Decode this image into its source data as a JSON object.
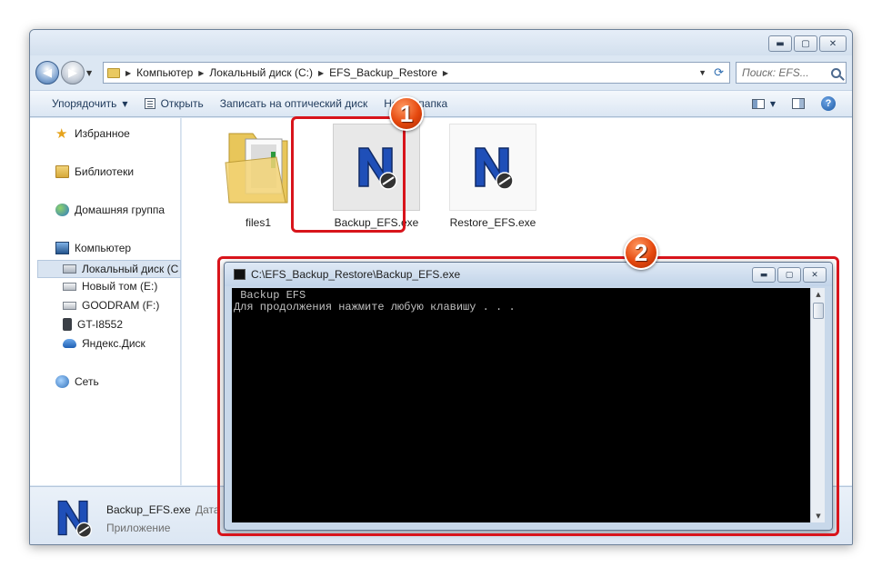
{
  "explorer": {
    "window_controls": {
      "minimize": "▬",
      "maximize": "▢",
      "close": "✕"
    },
    "nav": {
      "back": "◀",
      "forward": "▶",
      "history": "▼"
    },
    "address": {
      "crumbs": [
        "Компьютер",
        "Локальный диск (C:)",
        "EFS_Backup_Restore"
      ],
      "separator": "▶",
      "dropdown": "▼",
      "refresh": "⟳"
    },
    "search": {
      "placeholder": "Поиск: EFS..."
    },
    "toolbar": {
      "organize": "Упорядочить",
      "caret": "▼",
      "open": "Открыть",
      "burn": "Записать на оптический диск",
      "new_folder": "Новая папка",
      "help": "?"
    },
    "sidebar": {
      "favorites": "Избранное",
      "libraries": "Библиотеки",
      "homegroup": "Домашняя группа",
      "computer": "Компьютер",
      "local_disk": "Локальный диск (C",
      "new_volume": "Новый том (E:)",
      "goodram": "GOODRAM (F:)",
      "phone": "GT-I8552",
      "yandex": "Яндекс.Диск",
      "network": "Сеть",
      "star_glyph": "★"
    },
    "files": [
      {
        "name": "files1",
        "type": "folder"
      },
      {
        "name": "Backup_EFS.exe",
        "type": "exe",
        "selected": true
      },
      {
        "name": "Restore_EFS.exe",
        "type": "exe",
        "selected": false
      }
    ],
    "details": {
      "name": "Backup_EFS.exe",
      "date_label": "Дата",
      "type": "Приложение"
    }
  },
  "console": {
    "title": "C:\\EFS_Backup_Restore\\Backup_EFS.exe",
    "lines": [
      " Backup EFS",
      "Для продолжения нажмите любую клавишу . . ."
    ],
    "controls": {
      "minimize": "▬",
      "maximize": "▢",
      "close": "✕"
    },
    "scroll": {
      "up": "▲",
      "down": "▼"
    }
  },
  "annotations": {
    "marker1": "1",
    "marker2": "2"
  },
  "colors": {
    "highlight": "#d8141b",
    "marker": "#e5480e",
    "console_bg": "#000000"
  },
  "icons": {
    "exe": "n-logo-icon",
    "folder": "folder-icon"
  }
}
